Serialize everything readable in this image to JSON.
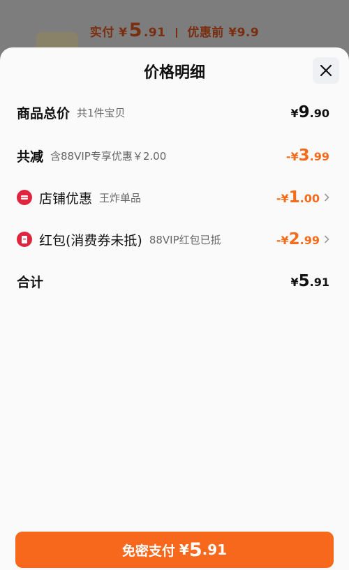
{
  "background": {
    "paid_label": "实付",
    "paid_currency": "¥",
    "paid_int": "5",
    "paid_dec": ".91",
    "original_label": "优惠前",
    "original_value": "¥9.9"
  },
  "sheet": {
    "title": "价格明细",
    "close_icon": "close-icon"
  },
  "rows": {
    "total": {
      "label": "商品总价",
      "sub": "共1件宝贝",
      "cur": "¥",
      "int": "9",
      "dec": ".90"
    },
    "discount": {
      "label": "共减",
      "sub": "含88VIP专享优惠￥2.00",
      "cur": "-¥",
      "int": "3",
      "dec": ".99"
    },
    "shop": {
      "label": "店铺优惠",
      "sub": "王炸单品",
      "cur": "-¥",
      "int": "1",
      "dec": ".00",
      "icon": "shop-coupon-icon"
    },
    "redpacket": {
      "label": "红包(消费券未抵)",
      "sub": "88VIP红包已抵",
      "cur": "-¥",
      "int": "2",
      "dec": ".99",
      "icon": "red-packet-icon"
    },
    "sum": {
      "label": "合计",
      "cur": "¥",
      "int": "5",
      "dec": ".91"
    }
  },
  "pay_button": {
    "label": "免密支付",
    "cur": "¥",
    "int": "5",
    "dec": ".91"
  },
  "colors": {
    "accent": "#f7681c",
    "discount": "#f46c1b",
    "badge": "#e0263f"
  }
}
